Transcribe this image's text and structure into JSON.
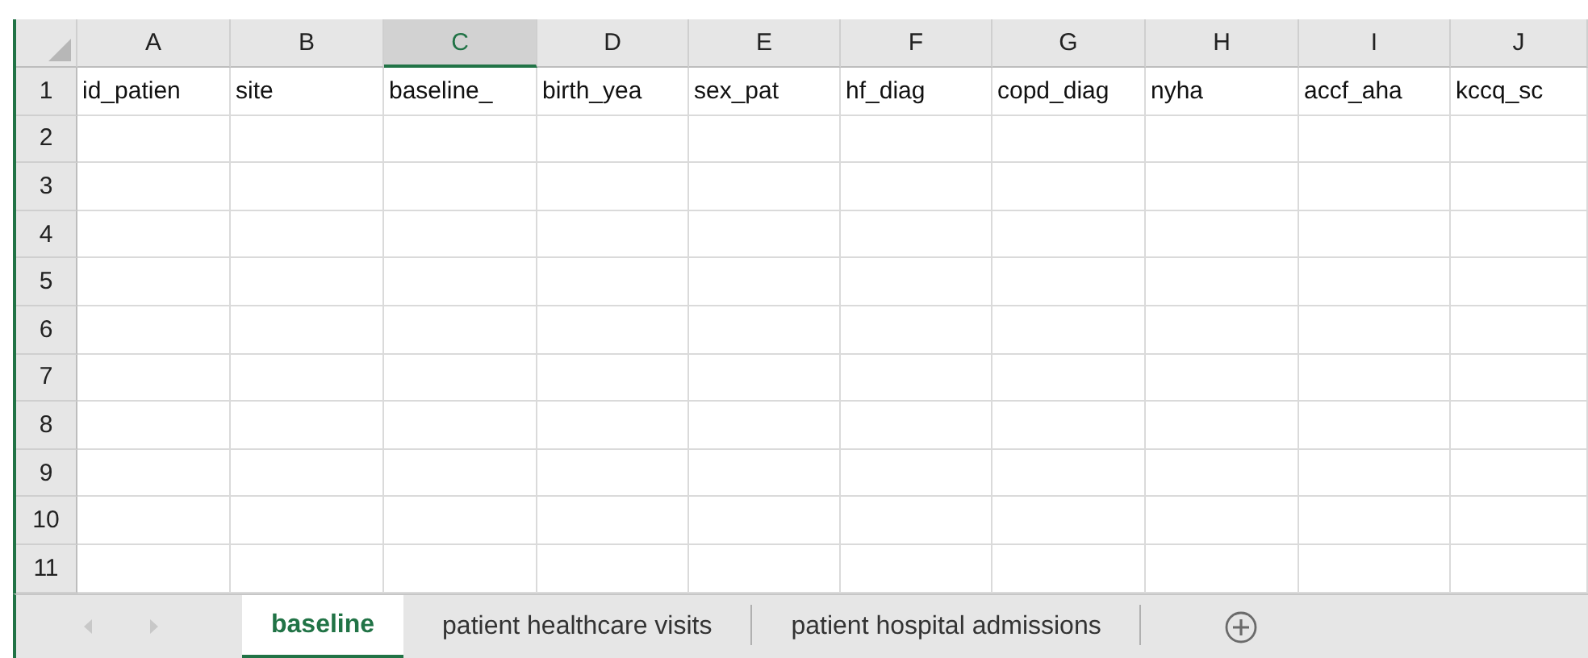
{
  "columns": [
    {
      "letter": "A",
      "selected": false
    },
    {
      "letter": "B",
      "selected": false
    },
    {
      "letter": "C",
      "selected": true
    },
    {
      "letter": "D",
      "selected": false
    },
    {
      "letter": "E",
      "selected": false
    },
    {
      "letter": "F",
      "selected": false
    },
    {
      "letter": "G",
      "selected": false
    },
    {
      "letter": "H",
      "selected": false
    },
    {
      "letter": "I",
      "selected": false
    },
    {
      "letter": "J",
      "selected": false
    }
  ],
  "rows": [
    {
      "number": "1",
      "cells": [
        "id_patien",
        "site",
        "baseline_",
        "birth_yea",
        "sex_pat",
        "hf_diag",
        "copd_diag",
        "nyha",
        "accf_aha",
        "kccq_sc"
      ]
    },
    {
      "number": "2",
      "cells": []
    },
    {
      "number": "3",
      "cells": []
    },
    {
      "number": "4",
      "cells": []
    },
    {
      "number": "5",
      "cells": []
    },
    {
      "number": "6",
      "cells": []
    },
    {
      "number": "7",
      "cells": []
    },
    {
      "number": "8",
      "cells": []
    },
    {
      "number": "9",
      "cells": []
    },
    {
      "number": "10",
      "cells": []
    },
    {
      "number": "11",
      "cells": []
    }
  ],
  "sheet_tabs": [
    {
      "label": "baseline",
      "selected": true
    },
    {
      "label": "patient healthcare visits",
      "selected": false
    },
    {
      "label": "patient hospital admissions",
      "selected": false
    }
  ]
}
